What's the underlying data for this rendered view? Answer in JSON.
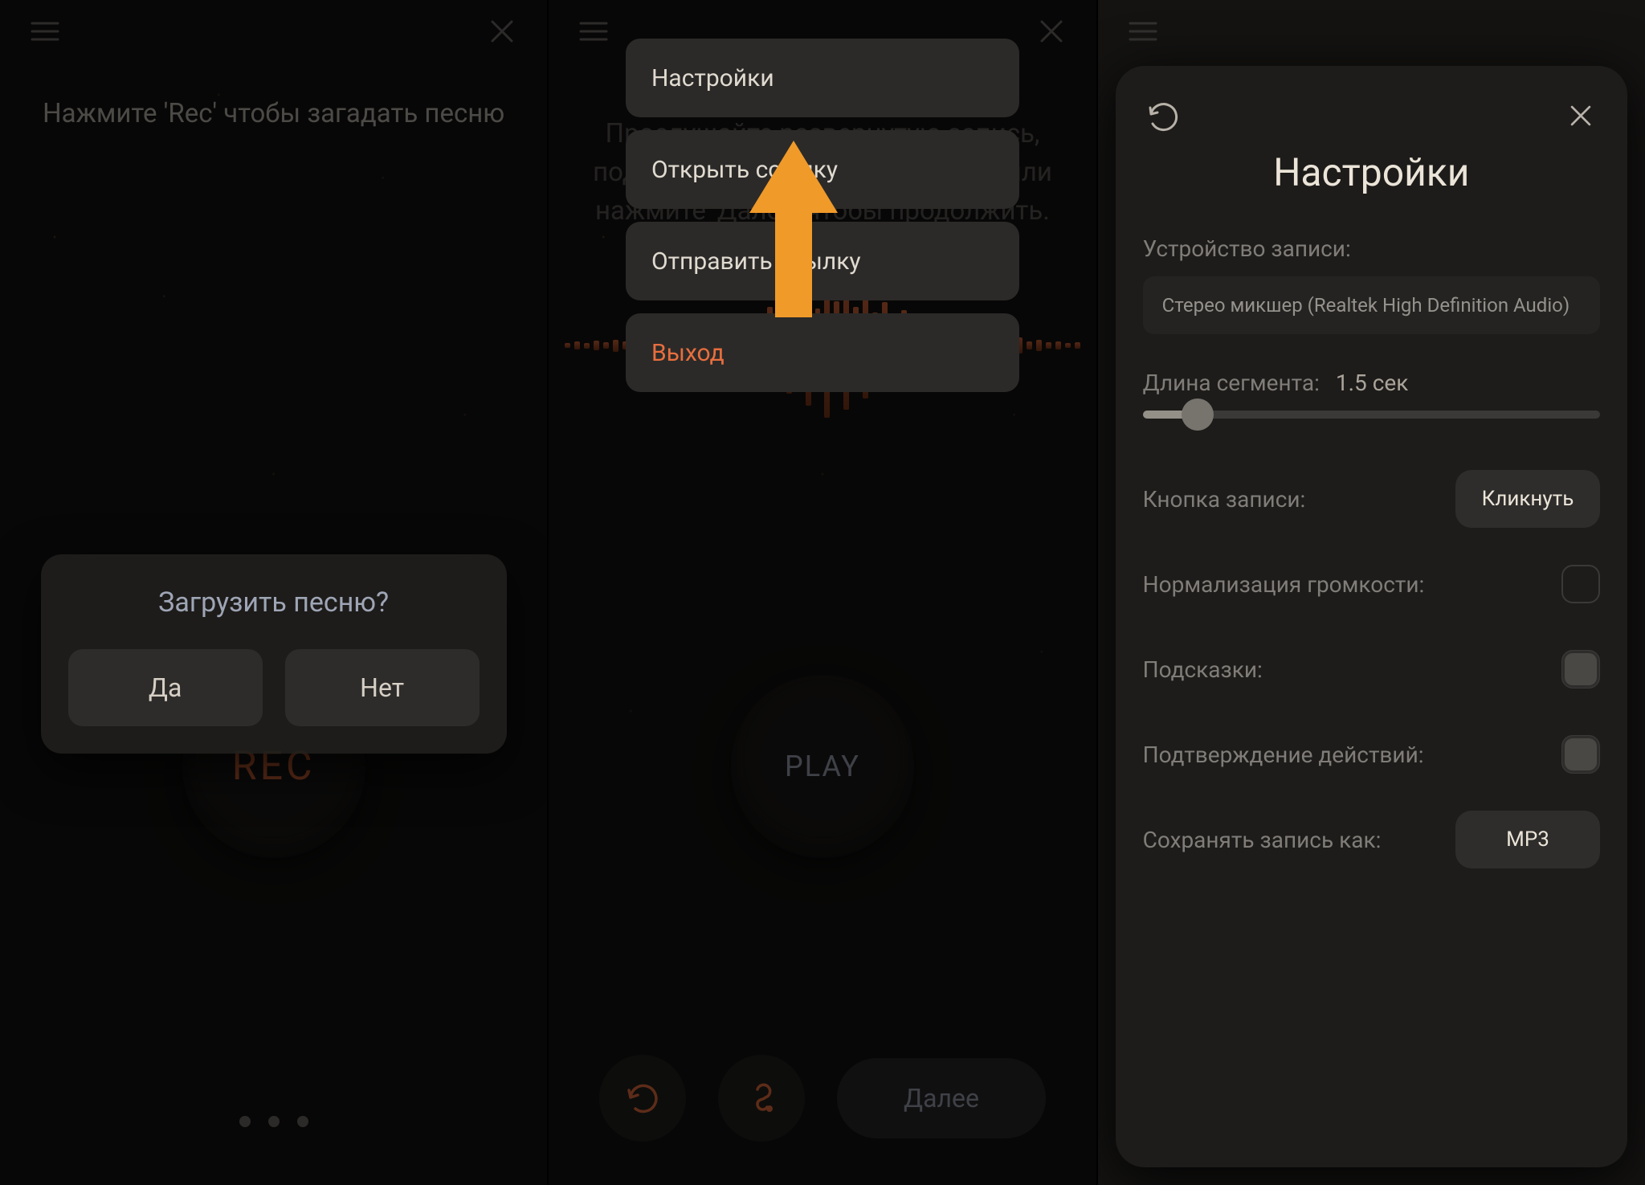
{
  "screen1": {
    "instruction": "Нажмите 'Rec' чтобы загадать песню",
    "recLabel": "REC",
    "dialog": {
      "question": "Загрузить песню?",
      "yes": "Да",
      "no": "Нет"
    }
  },
  "screen2": {
    "instruction": "Прослушайте развернутую запись, поделитесь записью с друзьями или нажмите 'Далее' чтобы продолжить.",
    "menu": {
      "settings": "Настройки",
      "openLink": "Открыть ссылку",
      "sendLink": "Отправить ссылку",
      "exit": "Выход"
    },
    "playLabel": "PLAY",
    "nextLabel": "Далее"
  },
  "screen3": {
    "title": "Настройки",
    "recordDeviceLabel": "Устройство записи:",
    "recordDeviceValue": "Стерео микшер (Realtek High Definition Audio)",
    "segmentLabel": "Длина сегмента:",
    "segmentValue": "1.5 сек",
    "segmentNumeric": 1.5,
    "segmentRange": [
      0,
      10
    ],
    "recordButtonLabel": "Кнопка записи:",
    "recordButtonValue": "Кликнуть",
    "normalizeLabel": "Нормализация громкости:",
    "normalizeValue": false,
    "hintsLabel": "Подсказки:",
    "hintsValue": true,
    "confirmLabel": "Подтверждение действий:",
    "confirmValue": true,
    "saveAsLabel": "Сохранять запись как:",
    "saveAsValue": "MP3"
  }
}
